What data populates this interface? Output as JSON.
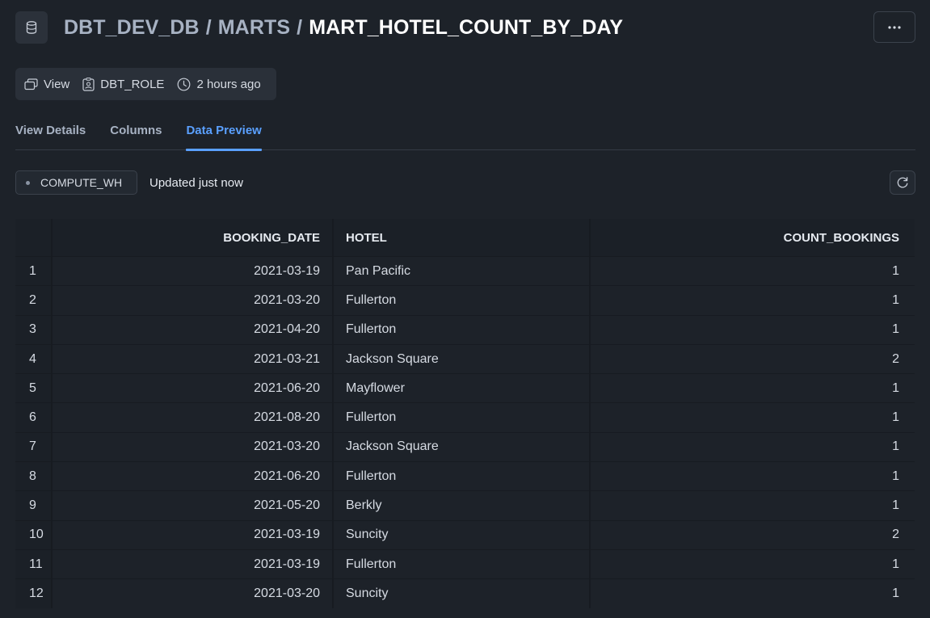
{
  "header": {
    "icon": "database-icon",
    "breadcrumb": {
      "database": "DBT_DEV_DB",
      "schema": "MARTS",
      "object": "MART_HOTEL_COUNT_BY_DAY",
      "separator": "/"
    },
    "more_icon": "ellipsis-icon"
  },
  "meta": {
    "type_label": "View",
    "role_label": "DBT_ROLE",
    "time_label": "2 hours ago"
  },
  "tabs": [
    {
      "label": "View Details",
      "active": false
    },
    {
      "label": "Columns",
      "active": false
    },
    {
      "label": "Data Preview",
      "active": true
    }
  ],
  "toolbar": {
    "warehouse": "COMPUTE_WH",
    "updated": "Updated just now",
    "refresh_icon": "refresh-icon"
  },
  "table": {
    "columns": [
      "",
      "BOOKING_DATE",
      "HOTEL",
      "COUNT_BOOKINGS"
    ],
    "rows": [
      {
        "idx": "1",
        "booking_date": "2021-03-19",
        "hotel": "Pan Pacific",
        "count": "1"
      },
      {
        "idx": "2",
        "booking_date": "2021-03-20",
        "hotel": "Fullerton",
        "count": "1"
      },
      {
        "idx": "3",
        "booking_date": "2021-04-20",
        "hotel": "Fullerton",
        "count": "1"
      },
      {
        "idx": "4",
        "booking_date": "2021-03-21",
        "hotel": "Jackson Square",
        "count": "2"
      },
      {
        "idx": "5",
        "booking_date": "2021-06-20",
        "hotel": "Mayflower",
        "count": "1"
      },
      {
        "idx": "6",
        "booking_date": "2021-08-20",
        "hotel": "Fullerton",
        "count": "1"
      },
      {
        "idx": "7",
        "booking_date": "2021-03-20",
        "hotel": "Jackson Square",
        "count": "1"
      },
      {
        "idx": "8",
        "booking_date": "2021-06-20",
        "hotel": "Fullerton",
        "count": "1"
      },
      {
        "idx": "9",
        "booking_date": "2021-05-20",
        "hotel": "Berkly",
        "count": "1"
      },
      {
        "idx": "10",
        "booking_date": "2021-03-19",
        "hotel": "Suncity",
        "count": "2"
      },
      {
        "idx": "11",
        "booking_date": "2021-03-19",
        "hotel": "Fullerton",
        "count": "1"
      },
      {
        "idx": "12",
        "booking_date": "2021-03-20",
        "hotel": "Suncity",
        "count": "1"
      }
    ]
  },
  "colors": {
    "background": "#1d2229",
    "accent": "#5aa0ff",
    "muted_text": "#a7b2c3"
  }
}
